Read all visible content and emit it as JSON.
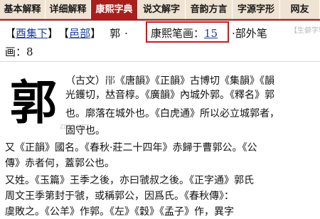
{
  "tabs": [
    {
      "label": "基本解释",
      "active": false
    },
    {
      "label": "详细解释",
      "active": false
    },
    {
      "label": "康熙字典",
      "active": true
    },
    {
      "label": "说文解字",
      "active": false
    },
    {
      "label": "音韵方言",
      "active": false
    },
    {
      "label": "字源字形",
      "active": false
    },
    {
      "label": "网友",
      "active": false
    }
  ],
  "header": {
    "bracket_open": "【",
    "bracket_close": "】",
    "ji_link": "酉集下",
    "bu_link": "邑部",
    "char": "郭",
    "sep": "·",
    "kangxi_label": "康熙笔画：",
    "kangxi_strokes": "15",
    "bu_wai_label": "部外笔",
    "line2": "画：8",
    "watermark": "【生僻字转"
  },
  "entry": {
    "big_char": "郭",
    "watermark": "ZDIC.NET",
    "lines": [
      "（古文）𨛡《唐韻》《正韻》古博切《集韻》《韻",
      "光鑊切，𠀤音椁。《廣韻》內城外郭。《釋名》郭",
      "也。廓落在城外也。《白虎通》所以必立城郭者，",
      "固守也。",
      "又《正韻》國名。《春秋·莊二十四年》赤歸于曹郭公。《公",
      "傳》赤者何，蓋郭公也。",
      "又姓。《玉篇》王季之後，亦曰虢叔之後。《正字通》郭氏",
      "周文王季第封于虢，或稱郭公，因爲氏。《春秋傳》：",
      "虞敗之。《公羊》作郭。《左》《穀》《孟子》作，異字"
    ]
  }
}
